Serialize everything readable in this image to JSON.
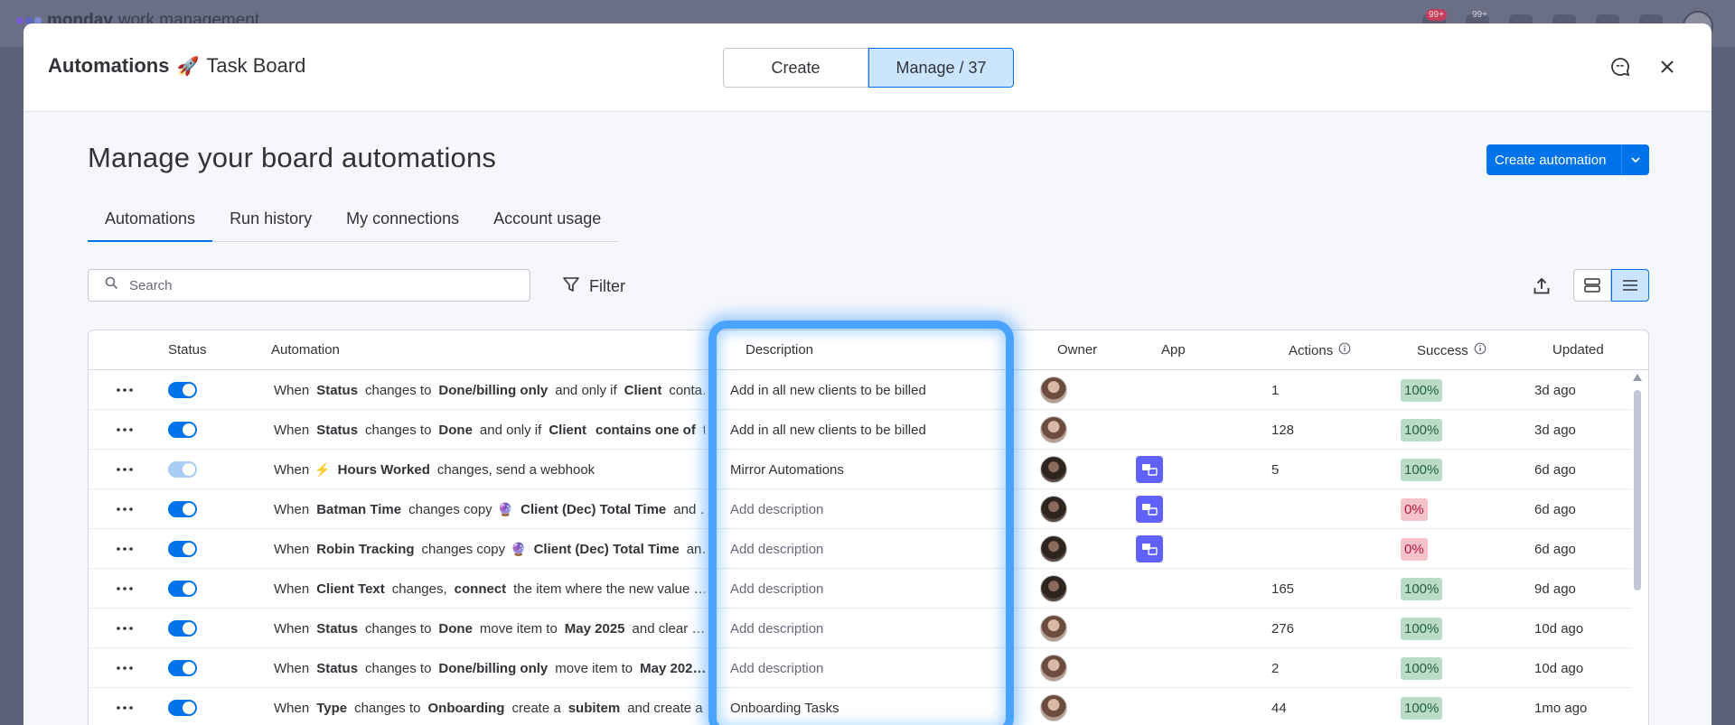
{
  "background": {
    "brand": "monday",
    "brand_suffix": "work management",
    "badges": [
      "99+",
      "99+"
    ]
  },
  "header": {
    "title": "Automations",
    "board_name": "Task Board",
    "board_icon": "rocket-icon",
    "tabs": [
      {
        "label": "Create",
        "active": false
      },
      {
        "label": "Manage / 37",
        "active": true
      }
    ]
  },
  "page": {
    "title": "Manage your board automations",
    "create_button": "Create automation",
    "tabs": [
      "Automations",
      "Run history",
      "My connections",
      "Account usage"
    ],
    "active_tab": "Automations",
    "search_placeholder": "Search",
    "filter_label": "Filter"
  },
  "table": {
    "columns": {
      "status": "Status",
      "automation": "Automation",
      "description": "Description",
      "owner": "Owner",
      "app": "App",
      "actions": "Actions",
      "success": "Success",
      "updated": "Updated"
    },
    "rows": [
      {
        "enabled": true,
        "automation": [
          [
            "n",
            "When"
          ],
          [
            "b",
            "Status"
          ],
          [
            "n",
            "changes to"
          ],
          [
            "b",
            "Done/billing only"
          ],
          [
            "n",
            "and only if"
          ],
          [
            "b",
            "Client"
          ],
          [
            "n",
            "conta…"
          ]
        ],
        "description": "Add in all new clients to be billed",
        "description_placeholder": false,
        "app": false,
        "actions": "1",
        "success": "100%",
        "updated": "3d ago"
      },
      {
        "enabled": true,
        "automation": [
          [
            "n",
            "When"
          ],
          [
            "b",
            "Status"
          ],
          [
            "n",
            "changes to"
          ],
          [
            "b",
            "Done"
          ],
          [
            "n",
            "and only if"
          ],
          [
            "b",
            "Client"
          ],
          [
            "b",
            "contains one of"
          ],
          [
            "n",
            "t…"
          ]
        ],
        "description": "Add in all new clients to be billed",
        "description_placeholder": false,
        "app": false,
        "actions": "128",
        "success": "100%",
        "updated": "3d ago"
      },
      {
        "enabled": false,
        "automation": [
          [
            "n",
            "When"
          ],
          [
            "i",
            "⚡"
          ],
          [
            "b",
            "Hours Worked"
          ],
          [
            "n",
            "changes, send a webhook"
          ]
        ],
        "description": "Mirror Automations",
        "description_placeholder": false,
        "app": true,
        "actions": "5",
        "success": "100%",
        "updated": "6d ago"
      },
      {
        "enabled": true,
        "automation": [
          [
            "n",
            "When"
          ],
          [
            "b",
            "Batman Time"
          ],
          [
            "n",
            "changes copy"
          ],
          [
            "i",
            "🔮"
          ],
          [
            "b",
            "Client (Dec) Total Time"
          ],
          [
            "n",
            "and …"
          ]
        ],
        "description": "Add description",
        "description_placeholder": true,
        "app": true,
        "actions": "",
        "success": "0%",
        "updated": "6d ago"
      },
      {
        "enabled": true,
        "automation": [
          [
            "n",
            "When"
          ],
          [
            "b",
            "Robin Tracking"
          ],
          [
            "n",
            "changes copy"
          ],
          [
            "i",
            "🔮"
          ],
          [
            "b",
            "Client (Dec) Total Time"
          ],
          [
            "n",
            "an…"
          ]
        ],
        "description": "Add description",
        "description_placeholder": true,
        "app": true,
        "actions": "",
        "success": "0%",
        "updated": "6d ago"
      },
      {
        "enabled": true,
        "automation": [
          [
            "n",
            "When"
          ],
          [
            "b",
            "Client Text"
          ],
          [
            "n",
            "changes,"
          ],
          [
            "b",
            "connect"
          ],
          [
            "n",
            "the item where the new value …"
          ]
        ],
        "description": "Add description",
        "description_placeholder": true,
        "app": false,
        "actions": "165",
        "success": "100%",
        "updated": "9d ago"
      },
      {
        "enabled": true,
        "automation": [
          [
            "n",
            "When"
          ],
          [
            "b",
            "Status"
          ],
          [
            "n",
            "changes to"
          ],
          [
            "b",
            "Done"
          ],
          [
            "n",
            "move item to"
          ],
          [
            "b",
            "May 2025"
          ],
          [
            "n",
            "and clear …"
          ]
        ],
        "description": "Add description",
        "description_placeholder": true,
        "app": false,
        "actions": "276",
        "success": "100%",
        "updated": "10d ago"
      },
      {
        "enabled": true,
        "automation": [
          [
            "n",
            "When"
          ],
          [
            "b",
            "Status"
          ],
          [
            "n",
            "changes to"
          ],
          [
            "b",
            "Done/billing only"
          ],
          [
            "n",
            "move item to"
          ],
          [
            "b",
            "May 202…"
          ]
        ],
        "description": "Add description",
        "description_placeholder": true,
        "app": false,
        "actions": "2",
        "success": "100%",
        "updated": "10d ago"
      },
      {
        "enabled": true,
        "automation": [
          [
            "n",
            "When"
          ],
          [
            "b",
            "Type"
          ],
          [
            "n",
            "changes to"
          ],
          [
            "b",
            "Onboarding"
          ],
          [
            "n",
            "create a"
          ],
          [
            "b",
            "subitem"
          ],
          [
            "n",
            "and create a …"
          ]
        ],
        "description": "Onboarding Tasks",
        "description_placeholder": false,
        "app": false,
        "actions": "44",
        "success": "100%",
        "updated": "1mo ago"
      }
    ]
  },
  "colors": {
    "primary": "#0073ea",
    "success_bg": "#bbdbc9",
    "fail_bg": "#f4c3c7",
    "highlight": "#4aa3ff"
  }
}
